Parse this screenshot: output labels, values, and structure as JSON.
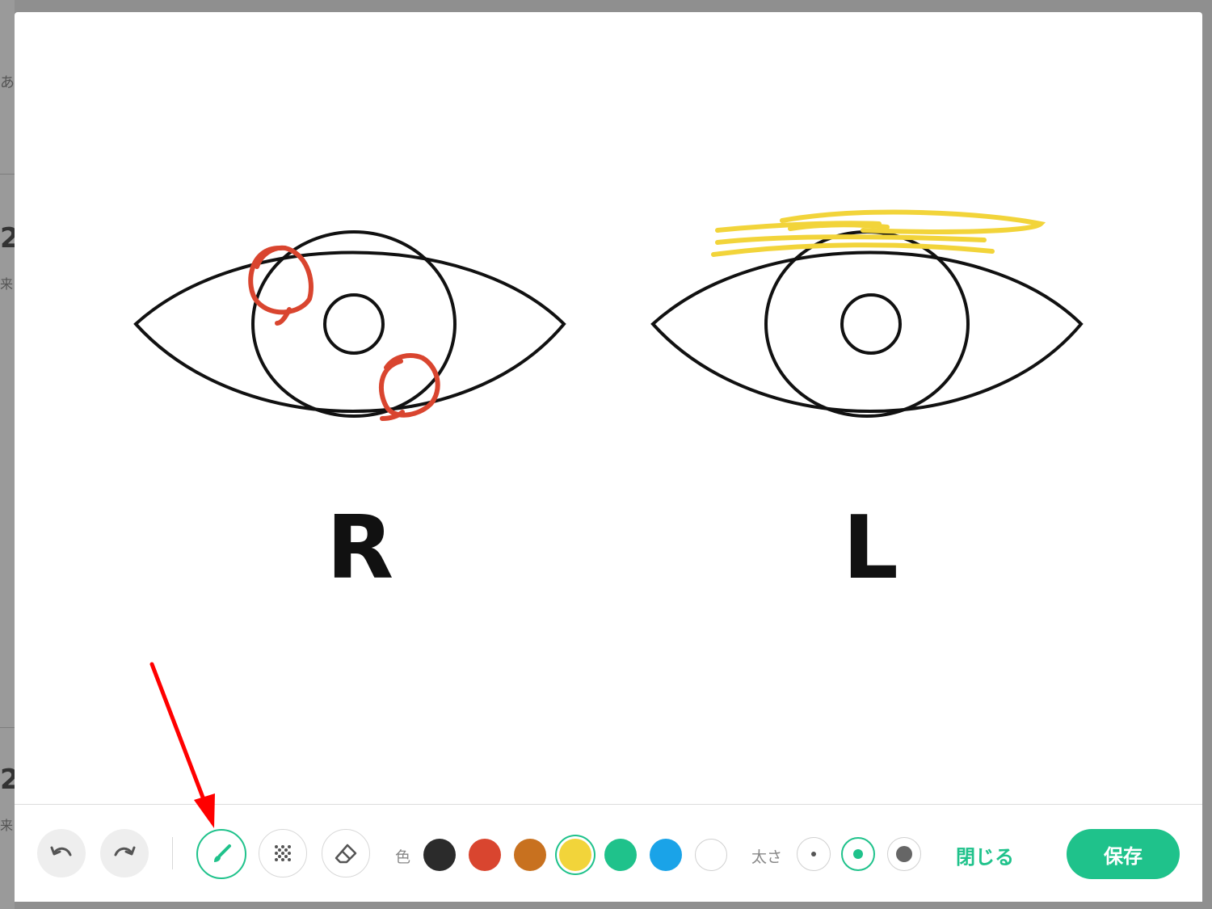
{
  "background": {
    "glyphs": [
      "あ",
      "2",
      "来",
      "2",
      "来"
    ]
  },
  "canvas": {
    "right_eye_label": "R",
    "left_eye_label": "L",
    "annotation_colors": {
      "red": "#d9452f",
      "yellow": "#f2d43a"
    }
  },
  "toolbar": {
    "undo_icon": "undo-icon",
    "redo_icon": "redo-icon",
    "pen_icon": "brush-icon",
    "pattern_icon": "dots-pattern-icon",
    "eraser_icon": "eraser-icon",
    "color_label": "色",
    "colors": [
      "#2b2b2b",
      "#d9452f",
      "#c8711f",
      "#f2d43a",
      "#1fc28b",
      "#1aa3e8",
      "#ffffff"
    ],
    "selected_color": "#f2d43a",
    "size_label": "太さ",
    "sizes": [
      "small",
      "medium",
      "large"
    ],
    "selected_size": "medium",
    "close_label": "閉じる",
    "save_label": "保存",
    "accent": "#1fc28b"
  }
}
